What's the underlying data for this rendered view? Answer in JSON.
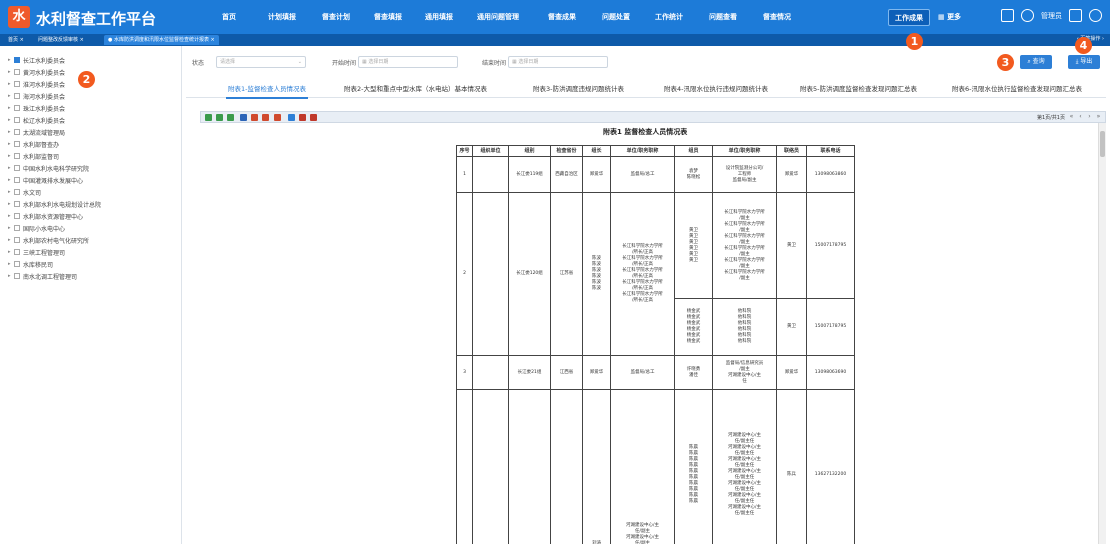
{
  "app": {
    "logo_text": "水",
    "title": "水利督查工作平台",
    "user": "管理员"
  },
  "nav": [
    {
      "label": "首页"
    },
    {
      "label": "计划填报"
    },
    {
      "label": "督查计划"
    },
    {
      "label": "督查填报"
    },
    {
      "label": "通用填报"
    },
    {
      "label": "通用问题管理"
    },
    {
      "label": "督查成果"
    },
    {
      "label": "问题处置"
    },
    {
      "label": "工作统计"
    },
    {
      "label": "问题查看"
    },
    {
      "label": "督查情况"
    },
    {
      "label": "工作成果"
    },
    {
      "label": "更多"
    }
  ],
  "tabs": [
    {
      "label": "首页 ×"
    },
    {
      "label": "问题整改反馈审核 ×"
    },
    {
      "label": "● 水库防洪调度和汛限水位监督检查统计报表 ×"
    }
  ],
  "tab_dropdown": "页签操作",
  "sidebar": {
    "items": [
      {
        "label": "长江水利委员会",
        "checked": true
      },
      {
        "label": "黄河水利委员会",
        "checked": false
      },
      {
        "label": "淮河水利委员会",
        "checked": false
      },
      {
        "label": "海河水利委员会",
        "checked": false
      },
      {
        "label": "珠江水利委员会",
        "checked": false
      },
      {
        "label": "松辽水利委员会",
        "checked": false
      },
      {
        "label": "太湖流域管理局",
        "checked": false
      },
      {
        "label": "水利部督查办",
        "checked": false
      },
      {
        "label": "水利部监督司",
        "checked": false
      },
      {
        "label": "中国水利水电科学研究院",
        "checked": false
      },
      {
        "label": "中国灌溉排水发展中心",
        "checked": false
      },
      {
        "label": "水文司",
        "checked": false
      },
      {
        "label": "水利部水利水电规划设计总院",
        "checked": false
      },
      {
        "label": "水利部水资源管理中心",
        "checked": false
      },
      {
        "label": "国际小水电中心",
        "checked": false
      },
      {
        "label": "水利部农村电气化研究所",
        "checked": false
      },
      {
        "label": "三峡工程管理司",
        "checked": false
      },
      {
        "label": "水库移民司",
        "checked": false
      },
      {
        "label": "南水北调工程管理司",
        "checked": false
      }
    ]
  },
  "filters": {
    "status_label": "状态",
    "status_placeholder": "请选择",
    "start_label": "开始时间",
    "start_placeholder": "选择日期",
    "end_label": "结束时间",
    "end_placeholder": "选择日期"
  },
  "buttons": {
    "query": "查询",
    "export": "导出"
  },
  "report_tabs": [
    {
      "label": "附表1-监督检查人员情况表"
    },
    {
      "label": "附表2-大型和重点中型水库（水电站）基本情况表"
    },
    {
      "label": "附表3-防洪调度违规问题统计表"
    },
    {
      "label": "附表4-汛限水位执行违规问题统计表"
    },
    {
      "label": "附表5-防洪调度监督检查发现问题汇总表"
    },
    {
      "label": "附表6-汛限水位执行监督检查发现问题汇总表"
    }
  ],
  "pager": {
    "text": "第1页/共1页"
  },
  "report": {
    "title": "附表1  监督检查人员情况表",
    "headers": [
      "序号",
      "组织单位",
      "组别",
      "检查省份",
      "组长",
      "单位/职务职称",
      "组员",
      "单位/职务职称",
      "联络员",
      "联系电话"
    ],
    "rows": [
      {
        "no": "1",
        "unit": "",
        "group": "长江委119组",
        "province": "西藏自治区",
        "leader": "郑爱华",
        "leader_title": "监督局/总工",
        "members": "袁梦\n陈晓松",
        "members_title": "设计院监测分公司/\n工程师\n监督局/副主",
        "liaison": "郑爱华",
        "phone": "13098063860"
      },
      {
        "no": "2",
        "unit": "",
        "group": "长江委120组",
        "province": "江苏省",
        "leader": "陈波\n陈波\n陈波\n陈波\n陈波\n陈波",
        "leader_title": "长江科学院水力学所\n/所长/正高\n长江科学院水力学所\n/所长/正高\n长江科学院水力学所\n/所长/正高\n长江科学院水力学所\n/所长/正高\n长江科学院水力学所\n/所长/正高",
        "members": "黄卫\n黄卫\n黄卫\n黄卫\n黄卫\n黄卫",
        "members_title": "长江科学院水力学所\n/副主\n长江科学院水力学所\n/副主\n长江科学院水力学所\n/副主\n长江科学院水力学所\n/副主\n长江科学院水力学所\n/副主\n长江科学院水力学所\n/副主",
        "liaison": "黄卫",
        "phone": "15007178795",
        "sub": {
          "members": "杨金武\n杨金武\n杨金武\n杨金武\n杨金武\n杨金武",
          "members_title": "他科院\n他科院\n他科院\n他科院\n他科院\n他科院",
          "liaison": "黄卫",
          "phone": "15007178795"
        }
      },
      {
        "no": "3",
        "unit": "",
        "group": "长江委21组",
        "province": "江西省",
        "leader": "郑爱华",
        "leader_title": "监督局/总工",
        "members": "许晓勇\n潘佳",
        "members_title": "监督局/信息研究员\n/副主\n河湖建设中心/主\n任",
        "liaison": "郑爱华",
        "phone": "13098063690"
      },
      {
        "no": "",
        "unit": "",
        "group": "",
        "province": "",
        "leader": "刘涛\n刘涛\n刘涛",
        "leader_title": "河湖建设中心/主\n任/副主\n河湖建设中心/主\n任/副主\n河湖建设中心/主\n任/副主",
        "members": "陈晨\n陈晨\n陈晨\n陈晨\n陈晨\n陈晨\n陈晨\n陈晨\n陈晨\n陈晨",
        "members_title": "河湖建设中心/主\n任/副主任\n河湖建设中心/主\n任/副主任\n河湖建设中心/主\n任/副主任\n河湖建设中心/主\n任/副主任\n河湖建设中心/主\n任/副主任\n河湖建设中心/主\n任/副主任\n河湖建设中心/主\n任/副主任",
        "liaison": "陈兵",
        "phone": "13627132200"
      }
    ]
  },
  "badges": [
    "1",
    "2",
    "3",
    "4"
  ],
  "colors": {
    "header": "#1d7bd8",
    "tabstrip": "#0e5aa9",
    "accent": "#2d7fd6",
    "badge": "#f25a1f"
  }
}
